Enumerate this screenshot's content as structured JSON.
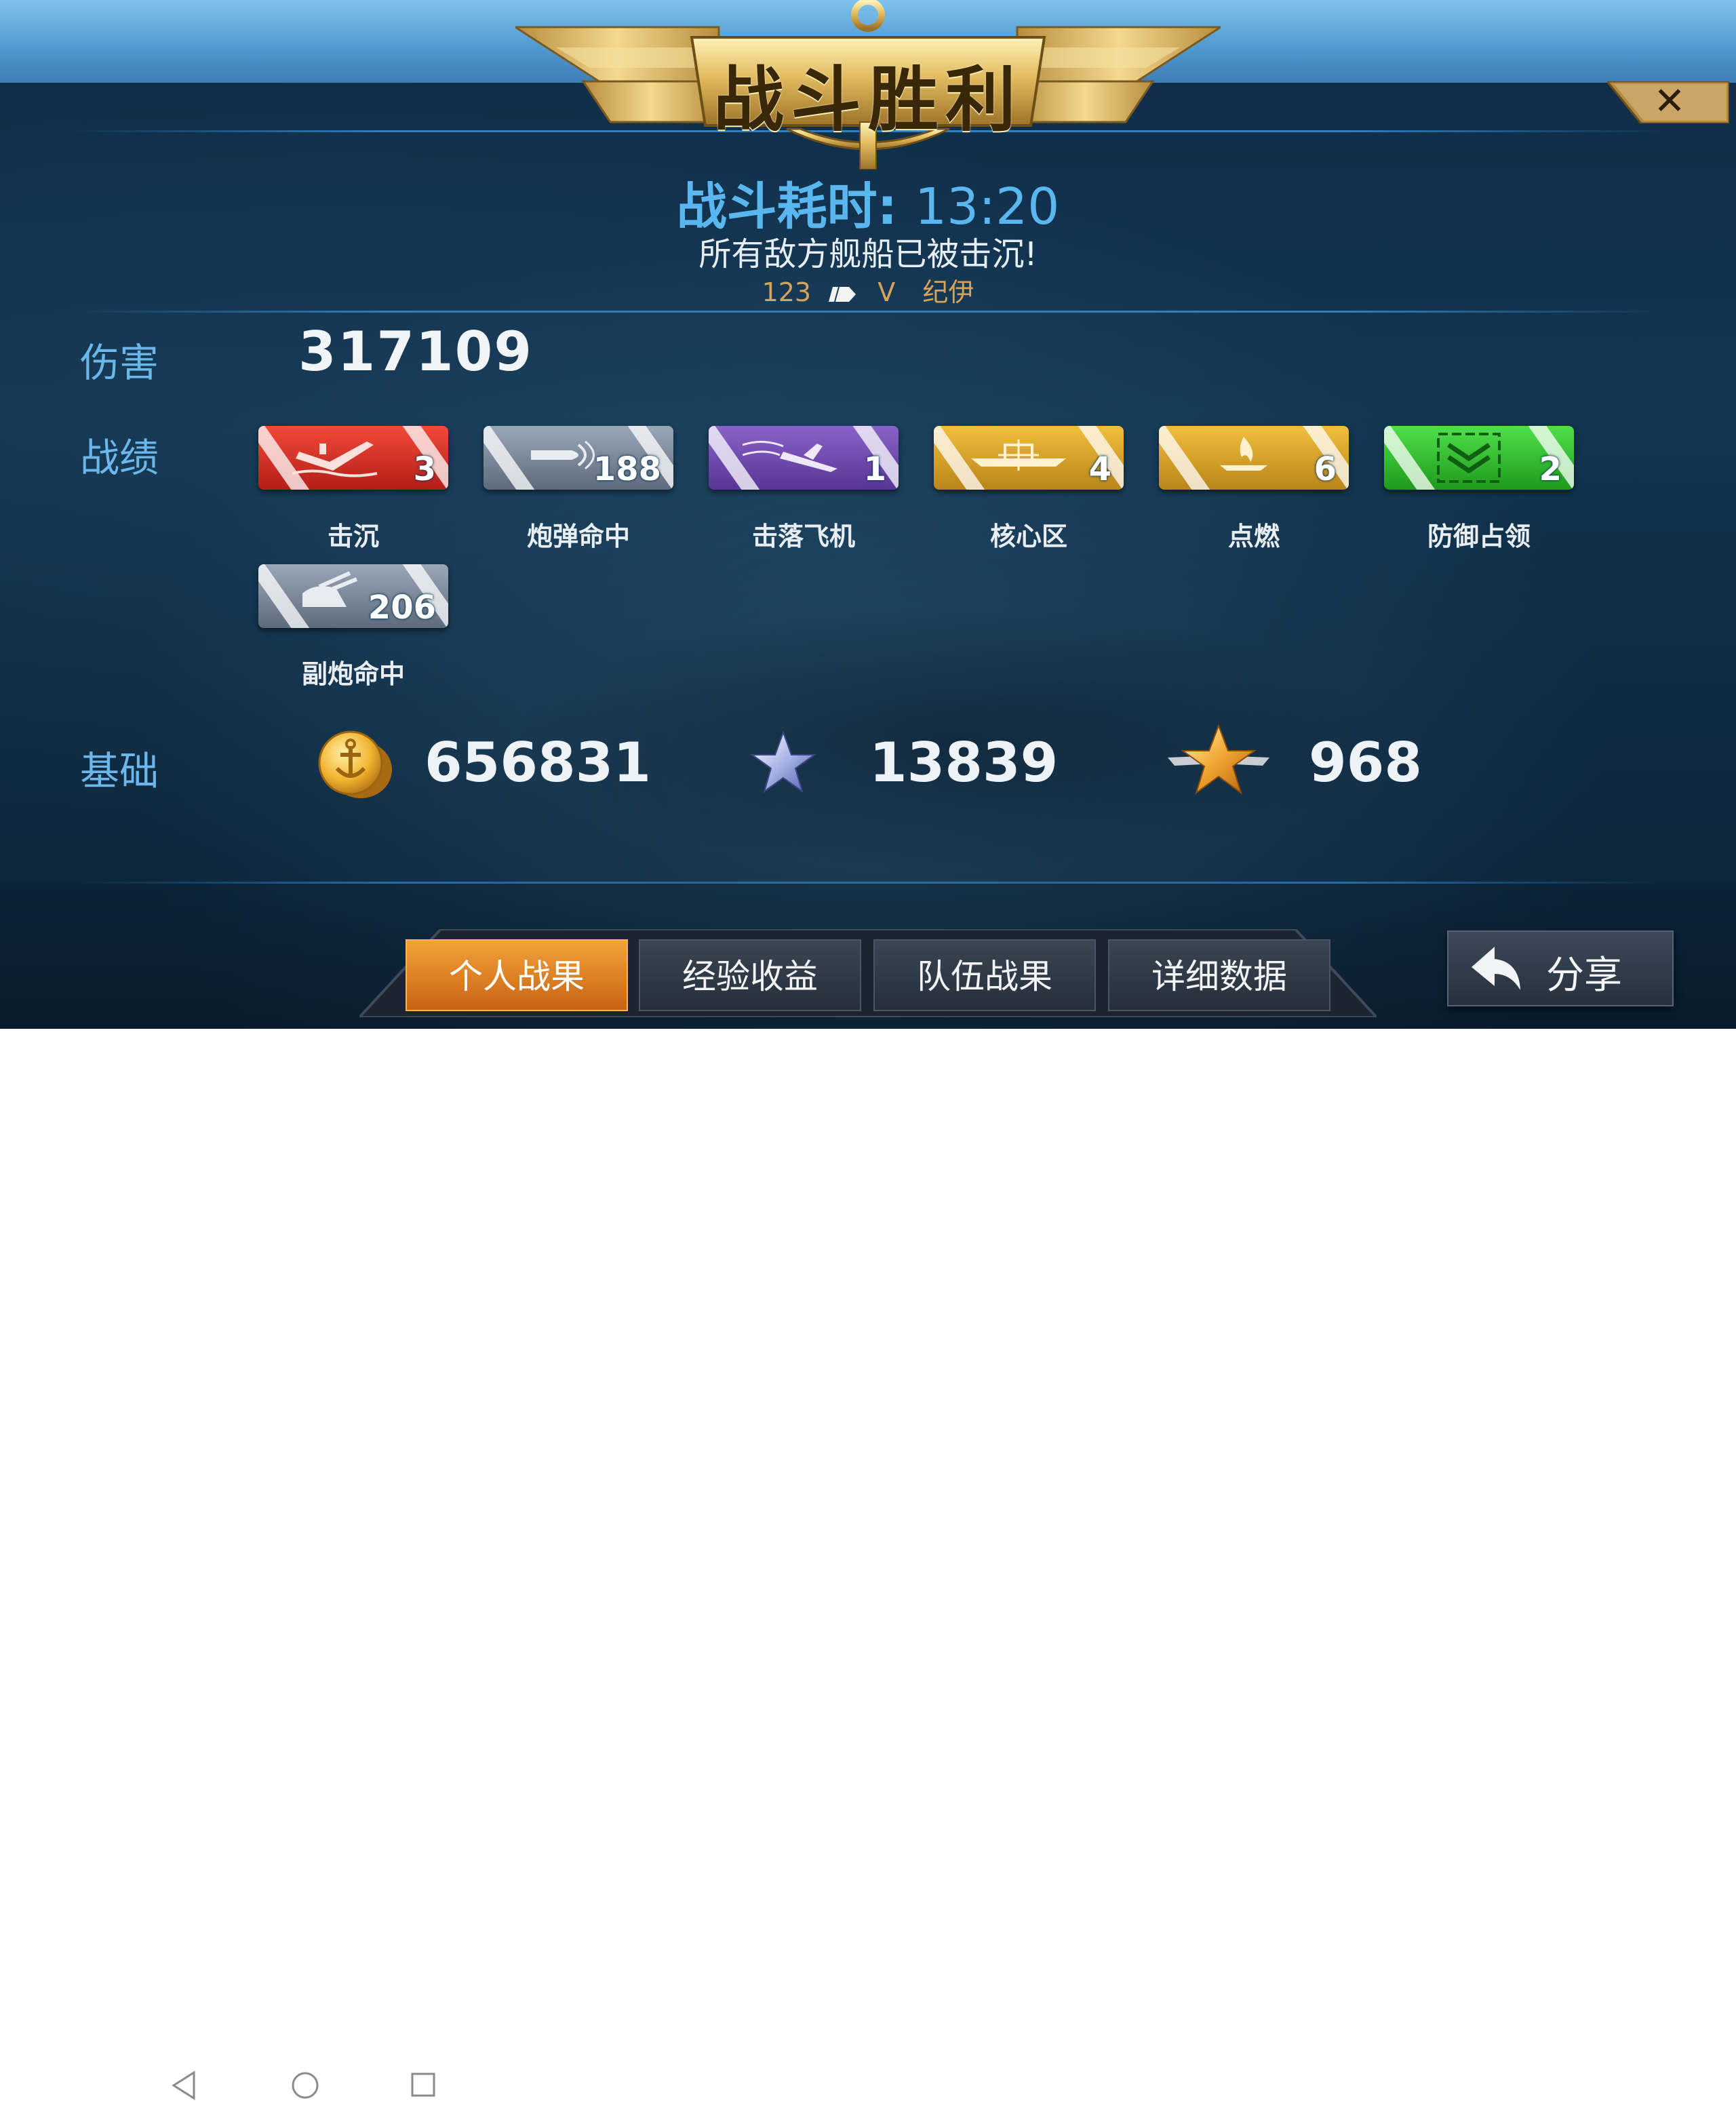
{
  "banner": {
    "title": "战斗胜利"
  },
  "header": {
    "duration_label": "战斗耗时:",
    "duration_value": "13:20",
    "result_message": "所有敌方舰船已被击沉!",
    "player_level": "123",
    "player_tier": "V",
    "player_ship": "纪伊"
  },
  "labels": {
    "damage": "伤害",
    "achievements": "战绩",
    "base": "基础"
  },
  "damage": {
    "value": "317109"
  },
  "achievements": [
    {
      "label": "击沉",
      "count": "3",
      "color": "#e8352a",
      "icon": "sinking-ship-icon"
    },
    {
      "label": "炮弹命中",
      "count": "188",
      "color": "#7d8a9c",
      "icon": "shell-icon"
    },
    {
      "label": "击落飞机",
      "count": "1",
      "color": "#7a4fb8",
      "icon": "plane-icon"
    },
    {
      "label": "核心区",
      "count": "4",
      "color": "#e3a92a",
      "icon": "citadel-icon"
    },
    {
      "label": "点燃",
      "count": "6",
      "color": "#e3a92a",
      "icon": "fire-icon"
    },
    {
      "label": "防御占领",
      "count": "2",
      "color": "#3bc63a",
      "icon": "defend-capture-icon"
    },
    {
      "label": "副炮命中",
      "count": "206",
      "color": "#7d8a9c",
      "icon": "secondary-gun-icon"
    }
  ],
  "base": {
    "coins": "656831",
    "experience": "13839",
    "commander_xp": "968"
  },
  "tabs": [
    {
      "label": "个人战果",
      "active": true
    },
    {
      "label": "经验收益",
      "active": false
    },
    {
      "label": "队伍战果",
      "active": false
    },
    {
      "label": "详细数据",
      "active": false
    }
  ],
  "share": {
    "label": "分享"
  },
  "colors": {
    "accent_blue": "#5ab6ef",
    "active_tab": "#e8892a",
    "gold_banner": "#d9b35a"
  }
}
